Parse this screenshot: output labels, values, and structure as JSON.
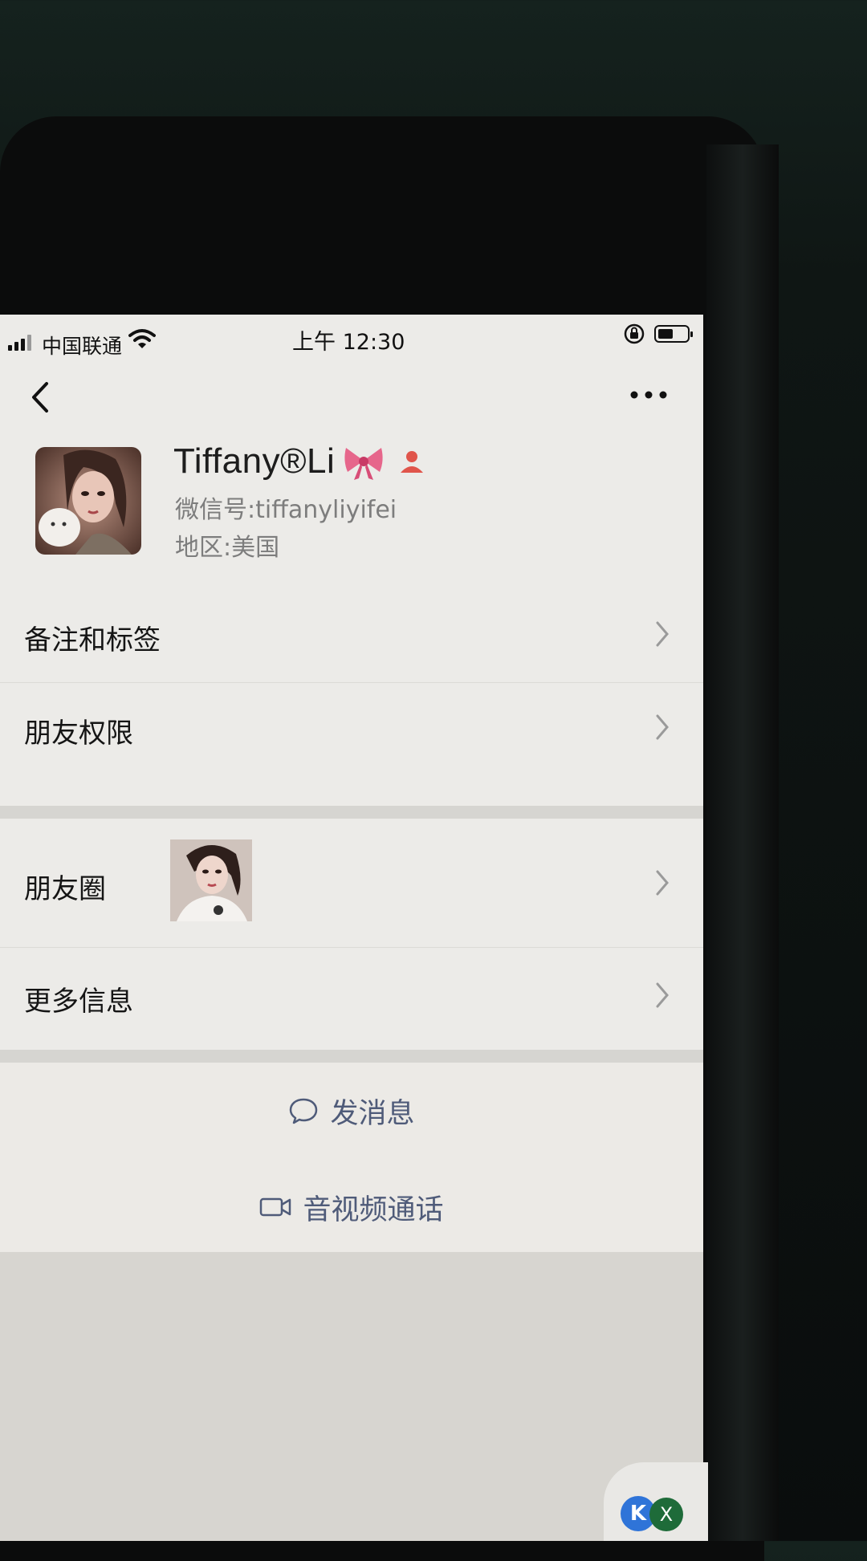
{
  "status_bar": {
    "carrier": "中国联通",
    "time": "上午 12:30",
    "battery_level": 0.45
  },
  "profile": {
    "name": "Tiffany®Li",
    "wechat_id_label": "微信号:",
    "wechat_id": "tiffanyliyifei",
    "region_label": "地区:",
    "region": "美国"
  },
  "list": {
    "remarks_tags": "备注和标签",
    "friend_permissions": "朋友权限",
    "moments": "朋友圈",
    "more_info": "更多信息"
  },
  "actions": {
    "send_message": "发消息",
    "video_call": "音视频通话"
  },
  "floating_widget": {
    "left_badge": "K",
    "right_badge": "X"
  },
  "colors": {
    "link_blue": "#4f5b79",
    "badge_red": "#e0554b",
    "page_bg": "#ecebe8"
  }
}
